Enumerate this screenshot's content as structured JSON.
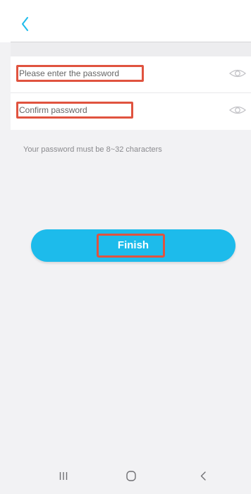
{
  "header": {
    "back_icon": "chevron-left-icon",
    "accent_color": "#1dbbeb"
  },
  "form": {
    "password": {
      "value": "",
      "placeholder": "Please enter the password",
      "visibility_icon": "eye-icon"
    },
    "confirm": {
      "value": "",
      "placeholder": "Confirm password",
      "visibility_icon": "eye-icon"
    },
    "hint": "Your password must be 8~32 characters",
    "highlight_color": "#e0533f"
  },
  "finish": {
    "label": "Finish",
    "color": "#1dbbeb"
  },
  "system_nav": {
    "recents_icon": "recents-icon",
    "home_icon": "home-icon",
    "back_icon": "back-icon"
  }
}
